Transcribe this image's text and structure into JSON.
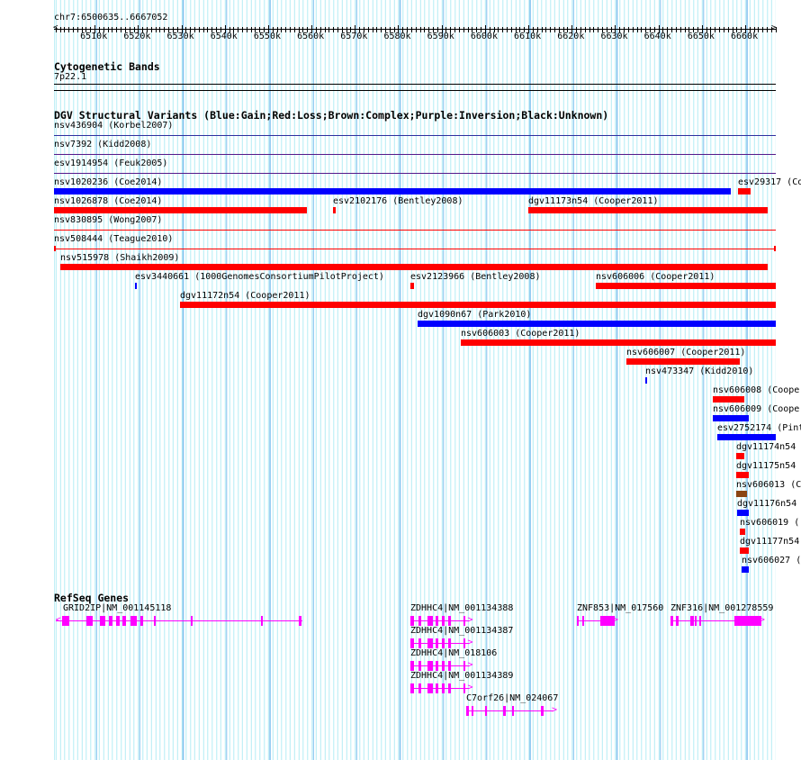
{
  "ruler": {
    "position": "chr7:6500635..6667052",
    "start": 6500635,
    "end": 6667052,
    "ticks": [
      "6510k",
      "6520k",
      "6530k",
      "6540k",
      "6550k",
      "6560k",
      "6570k",
      "6580k",
      "6590k",
      "6600k",
      "6610k",
      "6620k",
      "6630k",
      "6640k",
      "6650k",
      "6660k"
    ]
  },
  "cytobands": {
    "title": "Cytogenetic Bands",
    "band": "7p22.1"
  },
  "dgv": {
    "title": "DGV Structural Variants (Blue:Gain;Red:Loss;Brown:Complex;Purple:Inversion;Black:Unknown)",
    "colors": {
      "gain": "#0000ff",
      "loss": "#ff0000",
      "complex": "#8b4513",
      "inversion": "#551a8b",
      "unknown": "#000000",
      "line_blue": "#3030a0"
    },
    "rows": [
      [
        {
          "label": "nsv436904 (Korbel2007)",
          "type": "line_blue",
          "start": 6500.6,
          "end": 6667.1,
          "line": true
        }
      ],
      [
        {
          "label": "nsv7392 (Kidd2008)",
          "type": "inversion",
          "start": 6500.6,
          "end": 6667.1,
          "line": true
        }
      ],
      [
        {
          "label": "esv1914954 (Feuk2005)",
          "type": "inversion",
          "start": 6500.6,
          "end": 6667.1,
          "line": true
        }
      ],
      [
        {
          "label": "nsv1020236 (Coe2014)",
          "type": "gain",
          "start": 6500.6,
          "end": 6656.7
        },
        {
          "label": "esv29317 (Co",
          "type": "loss",
          "start": 6658.3,
          "end": 6661.2
        }
      ],
      [
        {
          "label": "nsv1026878 (Coe2014)",
          "type": "loss",
          "start": 6500.6,
          "end": 6558.9
        },
        {
          "label": "esv2102176 (Bentley2008)",
          "type": "loss",
          "start": 6564.9,
          "end": 6565.6
        },
        {
          "label": "dgv11173n54 (Cooper2011)",
          "type": "loss",
          "start": 6609.9,
          "end": 6665.1
        }
      ],
      [
        {
          "label": "nsv830895 (Wong2007)",
          "type": "loss",
          "start": 6500.6,
          "end": 6667.1,
          "line": true
        }
      ],
      [
        {
          "label": "nsv508444 (Teague2010)",
          "type": "loss",
          "start": 6500.6,
          "end": 6667.1,
          "line": true,
          "ends": true
        }
      ],
      [
        {
          "label": "nsv515978 (Shaikh2009)",
          "type": "loss",
          "start": 6502.1,
          "end": 6665.1
        }
      ],
      [
        {
          "label": "esv3440661 (1000GenomesConsortiumPilotProject)",
          "type": "gain",
          "start": 6519.3,
          "end": 6519.7
        },
        {
          "label": "esv2123966 (Bentley2008)",
          "type": "loss",
          "start": 6582.9,
          "end": 6583.7
        },
        {
          "label": "nsv606006 (Cooper2011)",
          "type": "loss",
          "start": 6625.6,
          "end": 6667.1
        }
      ],
      [
        {
          "label": "dgv11172n54 (Cooper2011)",
          "type": "loss",
          "start": 6529.6,
          "end": 6667.1
        }
      ],
      [
        {
          "label": "dgv1090n67 (Park2010)",
          "type": "gain",
          "start": 6584.4,
          "end": 6667.1
        }
      ],
      [
        {
          "label": "nsv606003 (Cooper2011)",
          "type": "loss",
          "start": 6594.5,
          "end": 6667.1
        }
      ],
      [
        {
          "label": "nsv606007 (Cooper2011)",
          "type": "loss",
          "start": 6632.6,
          "end": 6658.7
        }
      ],
      [
        {
          "label": "nsv473347 (Kidd2010)",
          "type": "gain",
          "start": 6636.9,
          "end": 6637.3
        }
      ],
      [
        {
          "label": "nsv606008 (Cooper",
          "type": "loss",
          "start": 6652.6,
          "end": 6659.7
        }
      ],
      [
        {
          "label": "nsv606009 (Cooper",
          "type": "gain",
          "start": 6652.6,
          "end": 6660.9
        }
      ],
      [
        {
          "label": "esv2752174 (Pint",
          "type": "gain",
          "start": 6653.6,
          "end": 6667.1
        }
      ],
      [
        {
          "label": "dgv11174n54",
          "type": "loss",
          "start": 6658.0,
          "end": 6659.7
        }
      ],
      [
        {
          "label": "dgv11175n54",
          "type": "loss",
          "start": 6658.0,
          "end": 6660.9
        }
      ],
      [
        {
          "label": "nsv606013 (C",
          "type": "complex",
          "start": 6658.0,
          "end": 6660.5
        }
      ],
      [
        {
          "label": "dgv11176n54",
          "type": "gain",
          "start": 6658.2,
          "end": 6660.9
        }
      ],
      [
        {
          "label": "nsv606019 (",
          "type": "loss",
          "start": 6658.7,
          "end": 6660.1
        }
      ],
      [
        {
          "label": "dgv11177n54",
          "type": "loss",
          "start": 6658.7,
          "end": 6660.9
        }
      ],
      [
        {
          "label": "nsv606027 (",
          "type": "gain",
          "start": 6659.1,
          "end": 6660.9
        }
      ]
    ]
  },
  "refseq": {
    "title": "RefSeq Genes",
    "color": "#ff00ff",
    "genes": [
      {
        "label": "GRID2IP|NM_001145118",
        "row": 0,
        "start": 6501.0,
        "end": 6558.0,
        "strand": "-",
        "exons": [
          [
            6502.4,
            6504.2
          ],
          [
            6508.2,
            6509.6
          ],
          [
            6511.2,
            6512.4
          ],
          [
            6513.2,
            6514.2
          ],
          [
            6515.0,
            6515.8
          ],
          [
            6516.5,
            6517.3
          ],
          [
            6518.3,
            6519.7
          ],
          [
            6520.5,
            6521.1
          ],
          [
            6523.7,
            6524.1
          ],
          [
            6532.2,
            6532.6
          ],
          [
            6548.4,
            6548.8
          ],
          [
            6557.0,
            6557.8
          ]
        ]
      },
      {
        "label": "ZDHHC4|NM_001134388",
        "row": 0,
        "start": 6582.9,
        "end": 6596.4,
        "strand": "+",
        "exons": [
          [
            6582.9,
            6583.6
          ],
          [
            6584.6,
            6585.2
          ],
          [
            6586.8,
            6588.0
          ],
          [
            6588.7,
            6589.3
          ],
          [
            6590.1,
            6590.7
          ],
          [
            6591.6,
            6592.2
          ],
          [
            6595.0,
            6595.4
          ]
        ]
      },
      {
        "label": "ZDHHC4|NM_001134387",
        "row": 1,
        "start": 6582.9,
        "end": 6596.4,
        "strand": "+",
        "exons": [
          [
            6582.9,
            6583.6
          ],
          [
            6584.6,
            6585.2
          ],
          [
            6586.8,
            6588.0
          ],
          [
            6588.7,
            6589.3
          ],
          [
            6590.1,
            6590.7
          ],
          [
            6591.6,
            6592.2
          ],
          [
            6595.0,
            6595.4
          ]
        ]
      },
      {
        "label": "ZDHHC4|NM_018106",
        "row": 2,
        "start": 6582.9,
        "end": 6596.4,
        "strand": "+",
        "exons": [
          [
            6582.9,
            6583.6
          ],
          [
            6584.6,
            6585.2
          ],
          [
            6586.8,
            6588.0
          ],
          [
            6588.7,
            6589.3
          ],
          [
            6590.1,
            6590.7
          ],
          [
            6591.6,
            6592.2
          ],
          [
            6595.0,
            6595.4
          ]
        ]
      },
      {
        "label": "ZDHHC4|NM_001134389",
        "row": 3,
        "start": 6582.9,
        "end": 6596.4,
        "strand": "+",
        "exons": [
          [
            6582.9,
            6583.6
          ],
          [
            6584.6,
            6585.2
          ],
          [
            6586.8,
            6588.0
          ],
          [
            6588.7,
            6589.3
          ],
          [
            6590.1,
            6590.7
          ],
          [
            6591.6,
            6592.2
          ],
          [
            6595.0,
            6595.4
          ]
        ]
      },
      {
        "label": "C7orf26|NM_024067",
        "row": 4,
        "start": 6595.7,
        "end": 6615.8,
        "strand": "+",
        "exons": [
          [
            6595.7,
            6596.4
          ],
          [
            6596.9,
            6597.4
          ],
          [
            6600.0,
            6600.4
          ],
          [
            6604.2,
            6604.9
          ],
          [
            6606.3,
            6606.7
          ],
          [
            6612.8,
            6613.6
          ]
        ]
      },
      {
        "label": "ZNF853|NM_017560",
        "row": 0,
        "start": 6621.2,
        "end": 6629.9,
        "strand": "+",
        "exons": [
          [
            6621.2,
            6621.7
          ],
          [
            6622.4,
            6622.9
          ],
          [
            6626.6,
            6629.9
          ]
        ]
      },
      {
        "label": "ZNF316|NM_001278559",
        "row": 0,
        "start": 6642.8,
        "end": 6663.7,
        "strand": "+",
        "exons": [
          [
            6642.8,
            6643.5
          ],
          [
            6644.1,
            6644.6
          ],
          [
            6647.3,
            6648.1
          ],
          [
            6648.3,
            6648.8
          ],
          [
            6649.4,
            6649.8
          ],
          [
            6657.5,
            6663.7
          ]
        ]
      }
    ]
  }
}
